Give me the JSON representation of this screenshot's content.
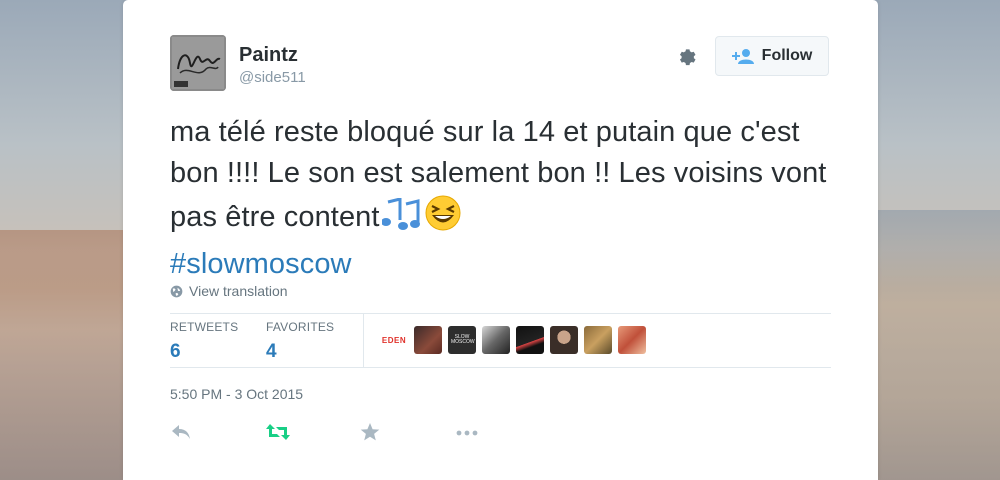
{
  "tweet": {
    "display_name": "Paintz",
    "handle": "@side511",
    "text_body": "ma télé reste bloqué sur la 14 et putain que c'est bon !!!! Le son est salement bon !! Les voisins vont pas être content",
    "emojis": [
      "notes-emoji",
      "grinning-squinting-emoji"
    ],
    "hashtag": "#slowmoscow",
    "view_translation": "View translation",
    "timestamp": "5:50 PM - 3 Oct 2015"
  },
  "header": {
    "follow_label": "Follow",
    "icons": [
      "gear-icon",
      "follow-user-icon"
    ]
  },
  "stats": {
    "retweets_label": "RETWEETS",
    "retweets_count": "6",
    "favorites_label": "FAVORITES",
    "favorites_count": "4"
  },
  "favoriters": {
    "first_label": "EDEN",
    "second_label": "SLOW MOSCOW",
    "count_shown": 8
  },
  "actions": [
    "reply-icon",
    "retweet-icon",
    "favorite-icon",
    "more-icon"
  ],
  "colors": {
    "link": "#2b7bb9",
    "retweet": "#19cf86",
    "muted": "#8899a6",
    "text": "#292f33"
  }
}
